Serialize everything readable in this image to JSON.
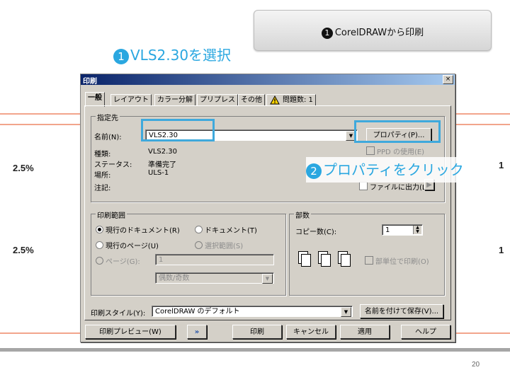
{
  "slide": {
    "step_header": {
      "num": "❶",
      "text": "CorelDRAWから印刷"
    },
    "step1": {
      "num": "1",
      "text": "VLS2.30を選択"
    },
    "step2": {
      "num": "2",
      "text": "プロパティをクリック"
    },
    "left_values": [
      "2.5%",
      "2.5%"
    ],
    "right_values": [
      "1",
      "1"
    ],
    "page_number": "20",
    "accent_color": "#2aa7e0"
  },
  "dialog": {
    "title": "印刷",
    "close_label": "×",
    "tabs": [
      "一般",
      "レイアウト",
      "カラー分解",
      "プリプレス",
      "その他",
      "問題数: 1"
    ],
    "destination": {
      "group_label": "指定先",
      "name_label": "名前(N):",
      "name_value": "VLS2.30",
      "properties_button": "プロパティ(P)...",
      "ppd_label": "PPD の使用(E)",
      "type_label": "種類:",
      "type_value": "VLS2.30",
      "status_label": "ステータス:",
      "status_value": "準備完了",
      "location_label": "場所:",
      "location_value": "ULS-1",
      "comment_label": "注記:",
      "print_to_file": "ファイルに出力(L)"
    },
    "range": {
      "group_label": "印刷範囲",
      "current_document": "現行のドキュメント(R)",
      "documents": "ドキュメント(T)",
      "current_page": "現行のページ(U)",
      "selection": "選択範囲(S)",
      "pages": "ページ(G):",
      "pages_value": "1",
      "even_odd": "偶数/奇数"
    },
    "copies": {
      "group_label": "部数",
      "copies_label": "コピー数(C):",
      "copies_value": "1",
      "collate": "部単位で印刷(O)"
    },
    "style": {
      "label": "印刷スタイル(Y):",
      "value": "CorelDRAW のデフォルト",
      "save_as": "名前を付けて保存(V)..."
    },
    "footer": {
      "preview": "印刷プレビュー(W)",
      "arrow": "»",
      "print": "印刷",
      "cancel": "キャンセル",
      "apply": "適用",
      "help": "ヘルプ"
    }
  }
}
